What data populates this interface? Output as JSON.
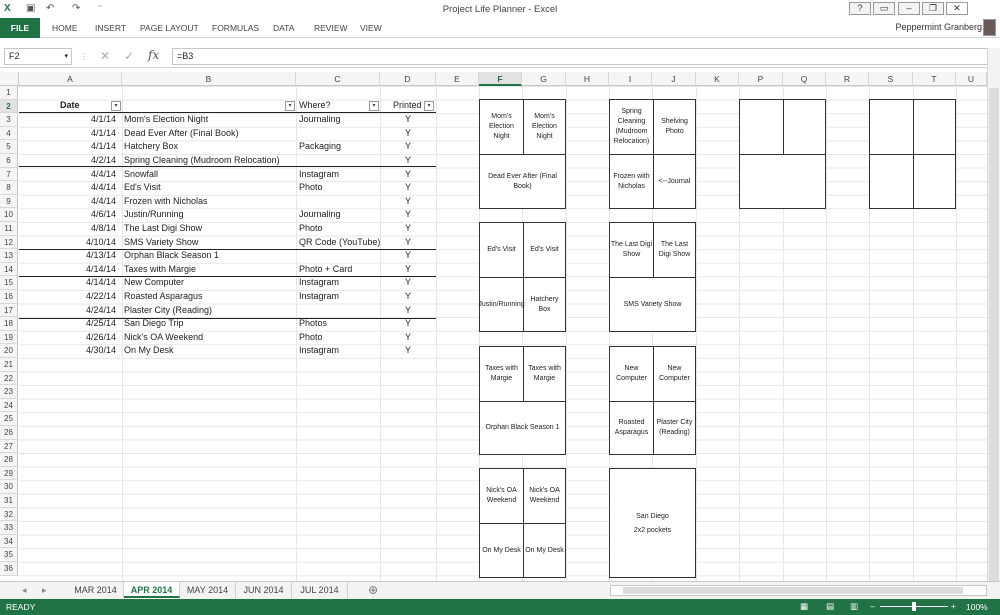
{
  "window": {
    "title": "Project Life Planner - Excel"
  },
  "ribbon": {
    "file": "FILE",
    "tabs": [
      "HOME",
      "INSERT",
      "PAGE LAYOUT",
      "FORMULAS",
      "DATA",
      "REVIEW",
      "VIEW"
    ],
    "user": "Peppermint Granberg"
  },
  "formula_bar": {
    "name_box": "F2",
    "formula": "=B3",
    "fx": "fx"
  },
  "columns": [
    "A",
    "B",
    "C",
    "D",
    "E",
    "F",
    "G",
    "H",
    "I",
    "J",
    "K",
    "P",
    "Q",
    "R",
    "S",
    "T",
    "U"
  ],
  "selected_column": "F",
  "rows_count": 36,
  "table": {
    "headers": [
      "Date",
      "",
      "Where?",
      "Printed"
    ],
    "rows": [
      [
        "4/1/14",
        "Mom's Election Night",
        "Journaling",
        "Y"
      ],
      [
        "4/1/14",
        "Dead Ever After (Final Book)",
        "",
        "Y"
      ],
      [
        "4/1/14",
        "Hatchery Box",
        "Packaging",
        "Y"
      ],
      [
        "4/2/14",
        "Spring Cleaning (Mudroom Relocation)",
        "",
        "Y"
      ],
      [
        "4/4/14",
        "Snowfall",
        "Instagram",
        "Y"
      ],
      [
        "4/4/14",
        "Ed's Visit",
        "Photo",
        "Y"
      ],
      [
        "4/4/14",
        "Frozen with Nicholas",
        "",
        "Y"
      ],
      [
        "4/6/14",
        "Justin/Running",
        "Journaling",
        "Y"
      ],
      [
        "4/8/14",
        "The Last Digi Show",
        "Photo",
        "Y"
      ],
      [
        "4/10/14",
        "SMS Variety Show",
        "QR Code (YouTube)",
        "Y"
      ],
      [
        "4/13/14",
        "Orphan Black Season 1",
        "",
        "Y"
      ],
      [
        "4/14/14",
        "Taxes with Margie",
        "Photo + Card",
        "Y"
      ],
      [
        "4/14/14",
        "New Computer",
        "Instagram",
        "Y"
      ],
      [
        "4/22/14",
        "Roasted Asparagus",
        "Instagram",
        "Y"
      ],
      [
        "4/24/14",
        "Plaster City (Reading)",
        "",
        "Y"
      ],
      [
        "4/25/14",
        "San Diego Trip",
        "Photos",
        "Y"
      ],
      [
        "4/26/14",
        "Nick's OA Weekend",
        "Photo",
        "Y"
      ],
      [
        "4/30/14",
        "On My Desk",
        "Instagram",
        "Y"
      ]
    ]
  },
  "pockets": {
    "f1": [
      "Mom's Election Night",
      "Mom's Election Night",
      "Dead Ever After (Final Book)"
    ],
    "f2": [
      "Ed's Visit",
      "Ed's Visit",
      "Justin/Running",
      "Hatchery Box"
    ],
    "f3": [
      "Taxes with Margie",
      "Taxes with Margie",
      "Orphan Black Season 1"
    ],
    "f4": [
      "Nick's OA Weekend",
      "Nick's OA Weekend",
      "On My Desk",
      "On My Desk"
    ],
    "i1": [
      "Spring Cleaning (Mudroom Relocation)",
      "Shelving Photo",
      "Frozen with Nicholas",
      "<--Journal"
    ],
    "i2": [
      "The Last Digi Show",
      "The Last Digi Show",
      "SMS Variety Show"
    ],
    "i3": [
      "New Computer",
      "New Computer",
      "Roasted Asparagus",
      "Plaster City (Reading)"
    ],
    "i4": [
      "San Diego",
      "2x2 pockets"
    ]
  },
  "sheets": [
    "MAR 2014",
    "APR 2014",
    "MAY 2014",
    "JUN 2014",
    "JUL 2014"
  ],
  "active_sheet": "APR 2014",
  "status": {
    "ready": "READY",
    "zoom": "100%"
  },
  "colors": {
    "excel_green": "#217346"
  }
}
